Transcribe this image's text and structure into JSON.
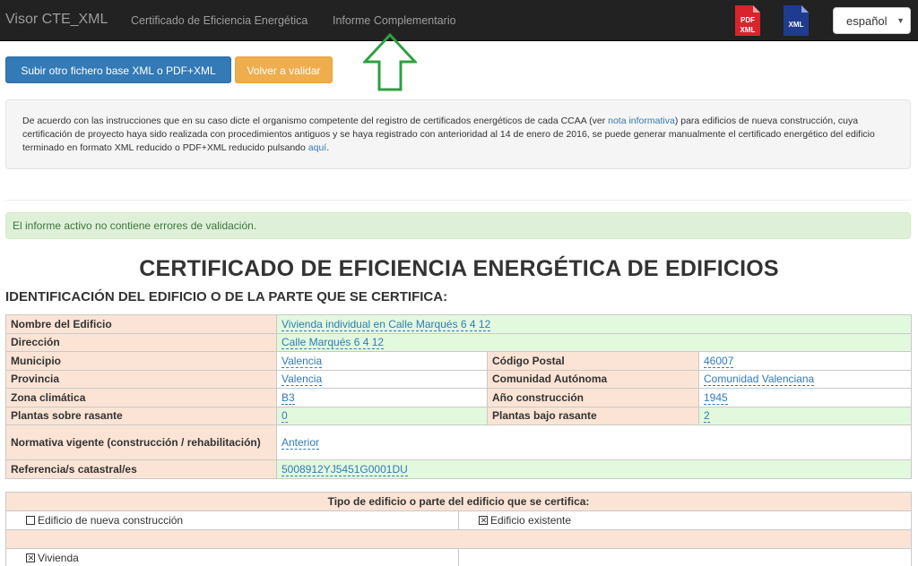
{
  "navbar": {
    "brand": "Visor CTE_XML",
    "links": [
      "Certificado de Eficiencia Energética",
      "Informe Complementario"
    ],
    "icons": [
      {
        "name": "pdf-xml-icon",
        "label_top": "PDF",
        "label_bottom": "XML",
        "color": "#d9232d"
      },
      {
        "name": "xml-icon",
        "label": "XML",
        "color": "#1f3b8f"
      }
    ],
    "language": "español"
  },
  "buttons": {
    "upload_label": "Subir otro fichero base XML o PDF+XML",
    "revalidate_label": "Volver a validar"
  },
  "info": {
    "text_1": "De acuerdo con las instrucciones que en su caso dicte el organismo competente del registro de certificados energéticos de cada CCAA (ver ",
    "link_1": "nota informativa",
    "text_2": ") para edificios de nueva construcción, cuya certificación de proyecto haya sido realizada con procedimientos antiguos y se haya registrado con anterioridad al 14 de enero de 2016, se puede generar manualmente el certificado energético del edificio terminado en formato XML reducido o PDF+XML reducido pulsando ",
    "link_2": "aquí",
    "text_3": "."
  },
  "alert": "El informe activo no contiene errores de validación.",
  "title": "CERTIFICADO DE EFICIENCIA ENERGÉTICA DE EDIFICIOS",
  "section": "IDENTIFICACIÓN DEL EDIFICIO O DE LA PARTE QUE SE CERTIFICA:",
  "identification": {
    "nombre_label": "Nombre del Edificio",
    "nombre": "Vivienda individual en Calle Marqués 6 4 12",
    "direccion_label": "Dirección",
    "direccion": "Calle Marqués 6 4 12",
    "municipio_label": "Municipio",
    "municipio": "Valencia",
    "cp_label": "Código Postal",
    "cp": "46007",
    "provincia_label": "Provincia",
    "provincia": "Valencia",
    "ccaa_label": "Comunidad Autónoma",
    "ccaa": "Comunidad Valenciana",
    "zona_label": "Zona climática",
    "zona": "B3",
    "anio_label": "Año construcción",
    "anio": "1945",
    "plantas_sobre_label": "Plantas sobre rasante",
    "plantas_sobre": "0",
    "plantas_bajo_label": "Plantas bajo rasante",
    "plantas_bajo": "2",
    "normativa_label": "Normativa vigente (construcción / rehabilitación)",
    "normativa": "Anterior",
    "catastral_label": "Referencia/s catastral/es",
    "catastral": "5008912YJ5451G0001DU"
  },
  "tipo": {
    "header": "Tipo de edificio o parte del edificio que se certifica:",
    "nueva": "Edificio de nueva construcción",
    "existente": "Edificio existente",
    "vivienda": "Vivienda"
  },
  "colors": {
    "label_bg": "#fbe4d5",
    "value_green_bg": "#e2f9de",
    "link": "#337ab7",
    "arrow": "#2ea043"
  }
}
